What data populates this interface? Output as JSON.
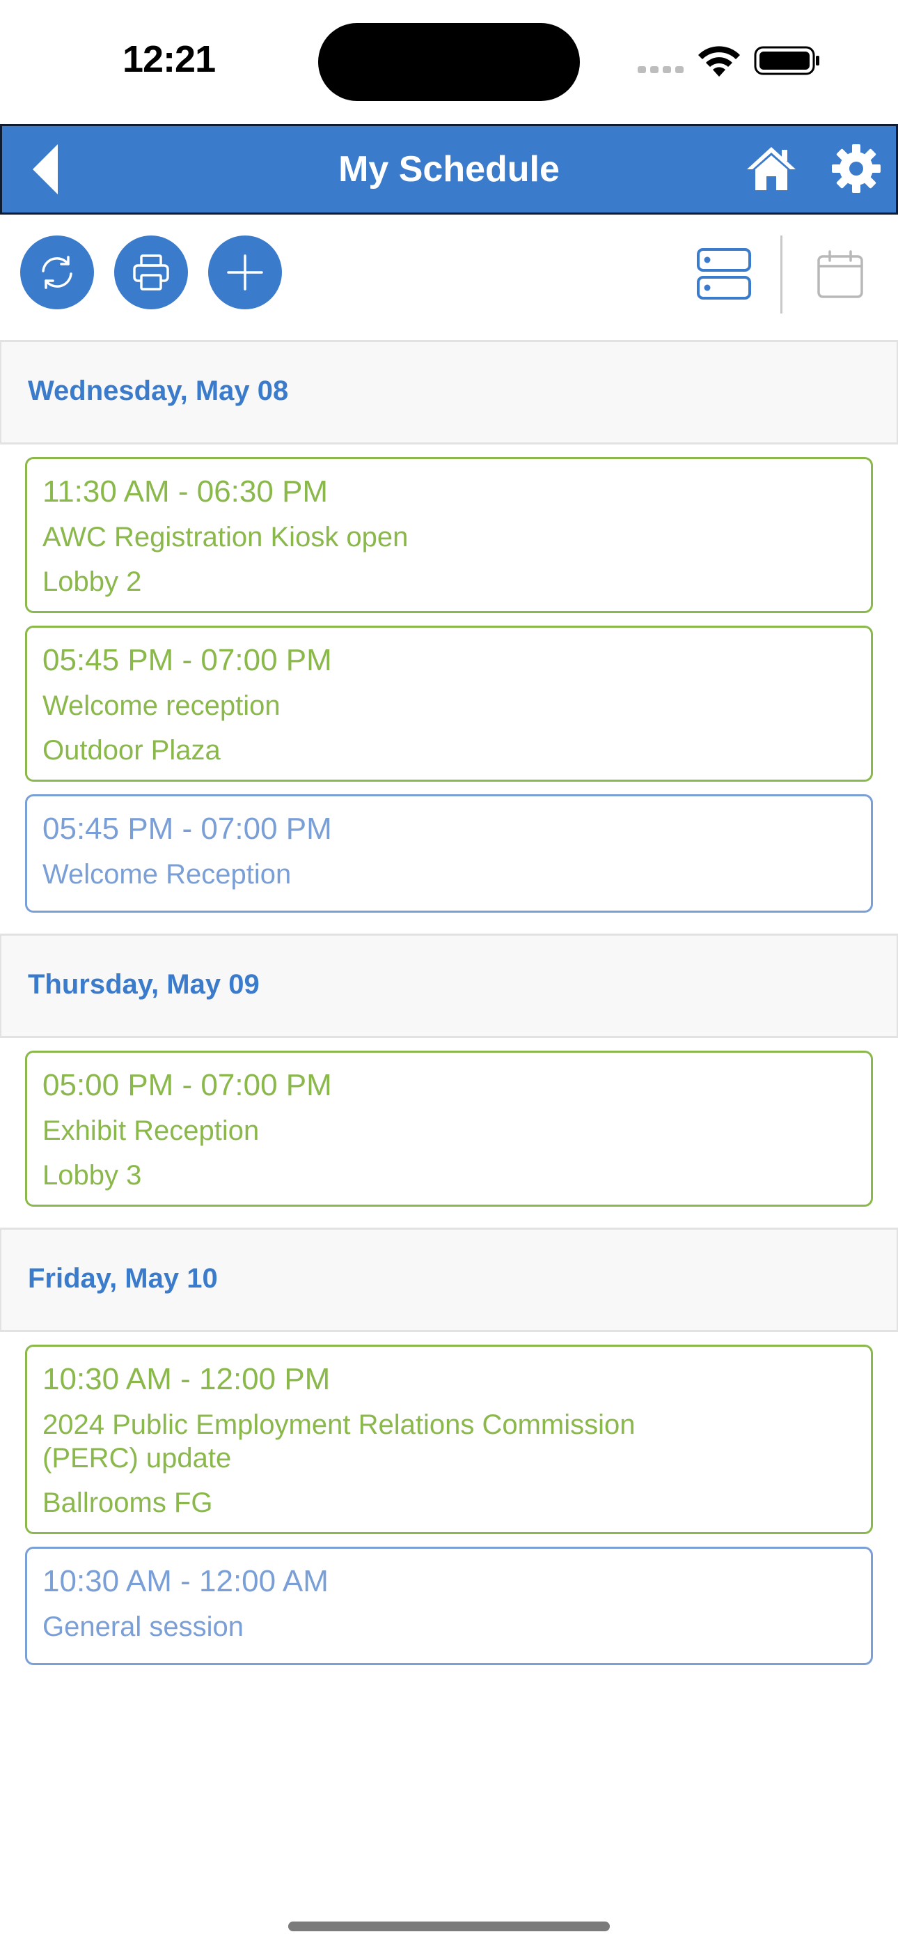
{
  "status_bar": {
    "time": "12:21"
  },
  "nav": {
    "title": "My Schedule"
  },
  "colors": {
    "accent": "#3b7bcb",
    "green_event": "#8ab84a",
    "blue_event": "#7a9fd6"
  },
  "toolbar": {
    "refresh_icon": "refresh-icon",
    "print_icon": "print-icon",
    "add_icon": "plus-icon",
    "list_view_icon": "list-view-icon",
    "calendar_view_icon": "calendar-icon"
  },
  "days": [
    {
      "label": "Wednesday, May 08",
      "events": [
        {
          "time": "11:30 AM - 06:30 PM",
          "title": "AWC Registration Kiosk open",
          "location": "Lobby 2",
          "color": "green"
        },
        {
          "time": "05:45 PM - 07:00 PM",
          "title": "Welcome reception",
          "location": "Outdoor Plaza",
          "color": "green"
        },
        {
          "time": "05:45 PM - 07:00 PM",
          "title": "Welcome Reception",
          "location": "",
          "color": "blue"
        }
      ]
    },
    {
      "label": "Thursday, May 09",
      "events": [
        {
          "time": "05:00 PM - 07:00 PM",
          "title": "Exhibit Reception",
          "location": "Lobby 3",
          "color": "green"
        }
      ]
    },
    {
      "label": "Friday, May 10",
      "events": [
        {
          "time": "10:30 AM - 12:00 PM",
          "title": "2024 Public Employment Relations Commission\n(PERC) update",
          "location": "Ballrooms FG",
          "color": "green"
        },
        {
          "time": "10:30 AM - 12:00 AM",
          "title": "General session",
          "location": "",
          "color": "blue"
        }
      ]
    }
  ]
}
